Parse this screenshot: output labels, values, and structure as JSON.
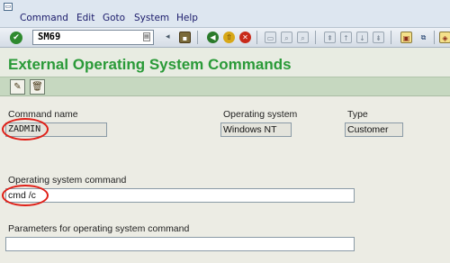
{
  "menu": {
    "system_icon": "system-menu-icon",
    "items": [
      "Command",
      "Edit",
      "Goto",
      "System",
      "Help"
    ]
  },
  "toolbar": {
    "command_value": "SM69",
    "icons": [
      "enter-icon",
      "save-icon",
      "back-icon",
      "exit-icon",
      "cancel-icon",
      "print-icon",
      "find-icon",
      "find-next-icon",
      "first-page-icon",
      "previous-page-icon",
      "next-page-icon",
      "last-page-icon",
      "create-session-icon",
      "shortcut-icon",
      "customize-layout-icon"
    ]
  },
  "page": {
    "title": "External Operating System Commands"
  },
  "app_toolbar": {
    "icons": [
      "edit-pencil-icon",
      "delete-trash-icon"
    ]
  },
  "form": {
    "command_name_label": "Command name",
    "command_name_value": "ZADMIN",
    "os_label": "Operating system",
    "os_value": "Windows NT",
    "type_label": "Type",
    "type_value": "Customer",
    "os_command_label": "Operating system command",
    "os_command_value": "cmd /c",
    "parameters_label": "Parameters for operating system command",
    "parameters_value": ""
  },
  "colors": {
    "title_green": "#2a9a38",
    "highlight_red": "#e02018",
    "app_toolbar_green": "#c6d8c0"
  }
}
